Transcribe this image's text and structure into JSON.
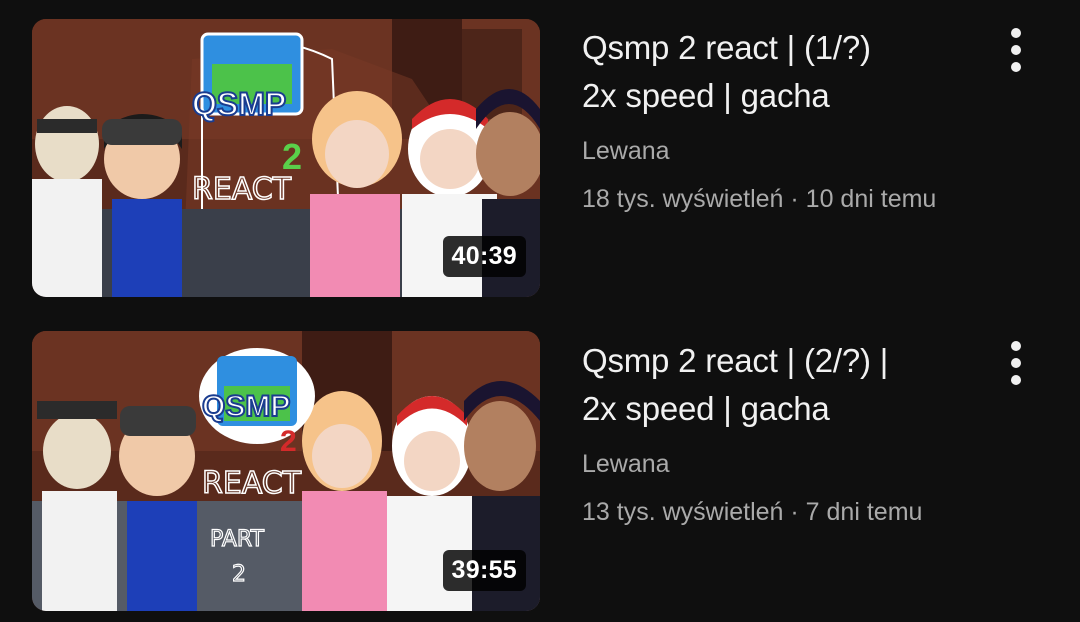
{
  "videos": [
    {
      "title_line1": "Qsmp 2 react | (1/?)",
      "title_line2": "2x speed | gacha",
      "channel": "Lewana",
      "stats": "18 tys. wyświetleń · 10 dni temu",
      "duration": "40:39",
      "thumb_logo": "QSMP",
      "thumb_logo_suffix": "2",
      "thumb_text": "REACT",
      "thumb_extra": "",
      "thumb_extra2": ""
    },
    {
      "title_line1": "Qsmp 2 react | (2/?) |",
      "title_line2": "2x speed | gacha",
      "channel": "Lewana",
      "stats": "13 tys. wyświetleń · 7 dni temu",
      "duration": "39:55",
      "thumb_logo": "QSMP",
      "thumb_logo_suffix": "2",
      "thumb_text": "REACT",
      "thumb_extra": "PART",
      "thumb_extra2": "2"
    }
  ],
  "icons": {
    "menu": "more-vert-icon"
  },
  "colors": {
    "background": "#0f0f0f",
    "primary_text": "#f1f1f1",
    "secondary_text": "#aaaaaa"
  }
}
